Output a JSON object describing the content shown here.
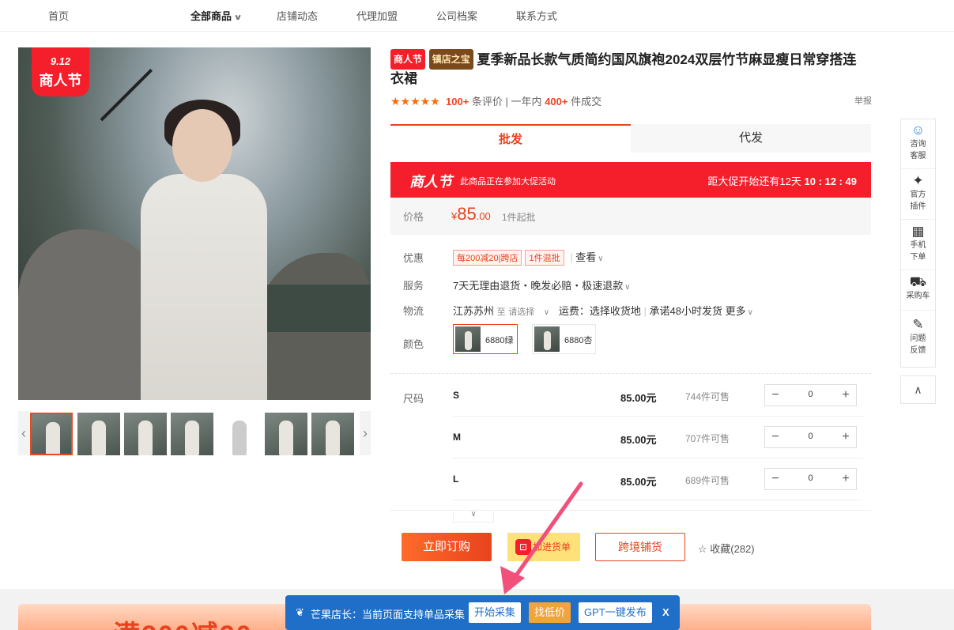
{
  "nav": {
    "home": "首页",
    "all_products": "全部商品",
    "store_news": "店铺动态",
    "agency": "代理加盟",
    "company": "公司档案",
    "contact": "联系方式"
  },
  "badge": {
    "date": "9.12",
    "event": "商人节"
  },
  "product": {
    "tag1": "商人节",
    "tag2": "镇店之宝",
    "title": "夏季新品长款气质简约国风旗袍2024双层竹节麻显瘦日常穿搭连衣裙",
    "stars": "★★★★★",
    "reviews_num": "100+",
    "reviews_label": "条评价",
    "year_label": "一年内",
    "deals_num": "400+",
    "deals_label": "件成交",
    "report": "举报"
  },
  "tabs": {
    "wholesale": "批发",
    "dropship": "代发"
  },
  "promo": {
    "logo": "商人节",
    "text": "此商品正在参加大促活动",
    "countdown_label": "距大促开始还有12天",
    "countdown_time": "10 : 12 : 49"
  },
  "price": {
    "label": "价格",
    "symbol": "¥",
    "integer": "85",
    "decimal": ".00",
    "moq": "1件起批"
  },
  "offers": {
    "label": "优惠",
    "coupon1": "每200减20|跨店",
    "coupon2": "1件混批",
    "view": "查看"
  },
  "service": {
    "label": "服务",
    "value": "7天无理由退货・晚发必赔・极速退款"
  },
  "logistics": {
    "label": "物流",
    "from": "江苏苏州",
    "to": "至",
    "select": "请选择",
    "fee": "运费：选择收货地",
    "promise": "承诺48小时发货",
    "more": "更多"
  },
  "colors": {
    "label": "颜色",
    "options": [
      "6880绿",
      "6880杏"
    ]
  },
  "sizes": {
    "label": "尺码",
    "rows": [
      {
        "size": "S",
        "price": "85.00元",
        "stock": "744件可售",
        "qty": "0"
      },
      {
        "size": "M",
        "price": "85.00元",
        "stock": "707件可售",
        "qty": "0"
      },
      {
        "size": "L",
        "price": "85.00元",
        "stock": "689件可售",
        "qty": "0"
      }
    ]
  },
  "actions": {
    "order": "立即订购",
    "cart": "加进货单",
    "cross": "跨境铺货",
    "fav": "收藏(282)"
  },
  "sidebar": {
    "service": "咨询客服",
    "plugin": "官方插件",
    "mobile": "手机下单",
    "cart": "采购车",
    "feedback": "问题反馈"
  },
  "banner": {
    "text": "满200减20"
  },
  "extension": {
    "message": "芒果店长：当前页面支持单品采集",
    "collect": "开始采集",
    "low_price": "找低价",
    "gpt": "GPT一键发布",
    "close": "X"
  },
  "colors_theme": {
    "accent": "#e8431e",
    "promo_red": "#f51e2b",
    "ext_blue": "#1f6fc9"
  }
}
